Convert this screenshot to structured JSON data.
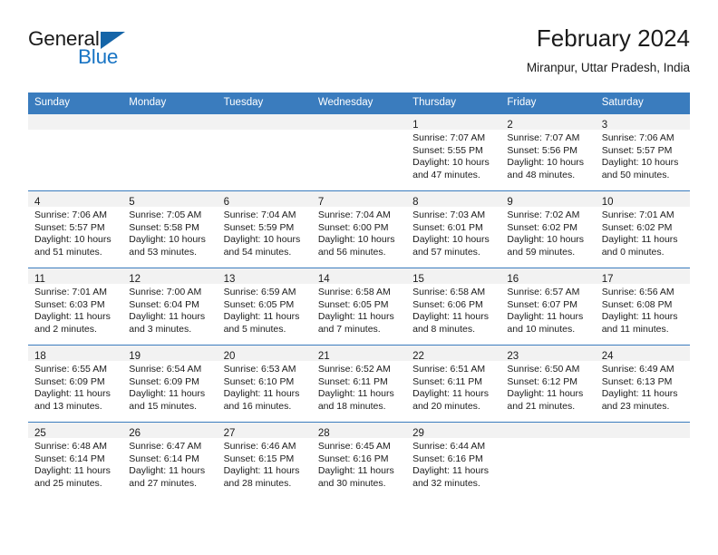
{
  "brand": {
    "name_part1": "General",
    "name_part2": "Blue",
    "triangle_color": "#1565a8",
    "blue_text_color": "#1874c4"
  },
  "header": {
    "title": "February 2024",
    "subtitle": "Miranpur, Uttar Pradesh, India"
  },
  "theme": {
    "header_bar_color": "#3a7cbe",
    "daynum_band_color": "#f2f2f2",
    "grid_line_color": "#3a7cbe"
  },
  "weekday_headers": [
    "Sunday",
    "Monday",
    "Tuesday",
    "Wednesday",
    "Thursday",
    "Friday",
    "Saturday"
  ],
  "weeks": [
    [
      {
        "day": "",
        "lines": []
      },
      {
        "day": "",
        "lines": []
      },
      {
        "day": "",
        "lines": []
      },
      {
        "day": "",
        "lines": []
      },
      {
        "day": "1",
        "lines": [
          "Sunrise: 7:07 AM",
          "Sunset: 5:55 PM",
          "Daylight: 10 hours",
          "and 47 minutes."
        ]
      },
      {
        "day": "2",
        "lines": [
          "Sunrise: 7:07 AM",
          "Sunset: 5:56 PM",
          "Daylight: 10 hours",
          "and 48 minutes."
        ]
      },
      {
        "day": "3",
        "lines": [
          "Sunrise: 7:06 AM",
          "Sunset: 5:57 PM",
          "Daylight: 10 hours",
          "and 50 minutes."
        ]
      }
    ],
    [
      {
        "day": "4",
        "lines": [
          "Sunrise: 7:06 AM",
          "Sunset: 5:57 PM",
          "Daylight: 10 hours",
          "and 51 minutes."
        ]
      },
      {
        "day": "5",
        "lines": [
          "Sunrise: 7:05 AM",
          "Sunset: 5:58 PM",
          "Daylight: 10 hours",
          "and 53 minutes."
        ]
      },
      {
        "day": "6",
        "lines": [
          "Sunrise: 7:04 AM",
          "Sunset: 5:59 PM",
          "Daylight: 10 hours",
          "and 54 minutes."
        ]
      },
      {
        "day": "7",
        "lines": [
          "Sunrise: 7:04 AM",
          "Sunset: 6:00 PM",
          "Daylight: 10 hours",
          "and 56 minutes."
        ]
      },
      {
        "day": "8",
        "lines": [
          "Sunrise: 7:03 AM",
          "Sunset: 6:01 PM",
          "Daylight: 10 hours",
          "and 57 minutes."
        ]
      },
      {
        "day": "9",
        "lines": [
          "Sunrise: 7:02 AM",
          "Sunset: 6:02 PM",
          "Daylight: 10 hours",
          "and 59 minutes."
        ]
      },
      {
        "day": "10",
        "lines": [
          "Sunrise: 7:01 AM",
          "Sunset: 6:02 PM",
          "Daylight: 11 hours",
          "and 0 minutes."
        ]
      }
    ],
    [
      {
        "day": "11",
        "lines": [
          "Sunrise: 7:01 AM",
          "Sunset: 6:03 PM",
          "Daylight: 11 hours",
          "and 2 minutes."
        ]
      },
      {
        "day": "12",
        "lines": [
          "Sunrise: 7:00 AM",
          "Sunset: 6:04 PM",
          "Daylight: 11 hours",
          "and 3 minutes."
        ]
      },
      {
        "day": "13",
        "lines": [
          "Sunrise: 6:59 AM",
          "Sunset: 6:05 PM",
          "Daylight: 11 hours",
          "and 5 minutes."
        ]
      },
      {
        "day": "14",
        "lines": [
          "Sunrise: 6:58 AM",
          "Sunset: 6:05 PM",
          "Daylight: 11 hours",
          "and 7 minutes."
        ]
      },
      {
        "day": "15",
        "lines": [
          "Sunrise: 6:58 AM",
          "Sunset: 6:06 PM",
          "Daylight: 11 hours",
          "and 8 minutes."
        ]
      },
      {
        "day": "16",
        "lines": [
          "Sunrise: 6:57 AM",
          "Sunset: 6:07 PM",
          "Daylight: 11 hours",
          "and 10 minutes."
        ]
      },
      {
        "day": "17",
        "lines": [
          "Sunrise: 6:56 AM",
          "Sunset: 6:08 PM",
          "Daylight: 11 hours",
          "and 11 minutes."
        ]
      }
    ],
    [
      {
        "day": "18",
        "lines": [
          "Sunrise: 6:55 AM",
          "Sunset: 6:09 PM",
          "Daylight: 11 hours",
          "and 13 minutes."
        ]
      },
      {
        "day": "19",
        "lines": [
          "Sunrise: 6:54 AM",
          "Sunset: 6:09 PM",
          "Daylight: 11 hours",
          "and 15 minutes."
        ]
      },
      {
        "day": "20",
        "lines": [
          "Sunrise: 6:53 AM",
          "Sunset: 6:10 PM",
          "Daylight: 11 hours",
          "and 16 minutes."
        ]
      },
      {
        "day": "21",
        "lines": [
          "Sunrise: 6:52 AM",
          "Sunset: 6:11 PM",
          "Daylight: 11 hours",
          "and 18 minutes."
        ]
      },
      {
        "day": "22",
        "lines": [
          "Sunrise: 6:51 AM",
          "Sunset: 6:11 PM",
          "Daylight: 11 hours",
          "and 20 minutes."
        ]
      },
      {
        "day": "23",
        "lines": [
          "Sunrise: 6:50 AM",
          "Sunset: 6:12 PM",
          "Daylight: 11 hours",
          "and 21 minutes."
        ]
      },
      {
        "day": "24",
        "lines": [
          "Sunrise: 6:49 AM",
          "Sunset: 6:13 PM",
          "Daylight: 11 hours",
          "and 23 minutes."
        ]
      }
    ],
    [
      {
        "day": "25",
        "lines": [
          "Sunrise: 6:48 AM",
          "Sunset: 6:14 PM",
          "Daylight: 11 hours",
          "and 25 minutes."
        ]
      },
      {
        "day": "26",
        "lines": [
          "Sunrise: 6:47 AM",
          "Sunset: 6:14 PM",
          "Daylight: 11 hours",
          "and 27 minutes."
        ]
      },
      {
        "day": "27",
        "lines": [
          "Sunrise: 6:46 AM",
          "Sunset: 6:15 PM",
          "Daylight: 11 hours",
          "and 28 minutes."
        ]
      },
      {
        "day": "28",
        "lines": [
          "Sunrise: 6:45 AM",
          "Sunset: 6:16 PM",
          "Daylight: 11 hours",
          "and 30 minutes."
        ]
      },
      {
        "day": "29",
        "lines": [
          "Sunrise: 6:44 AM",
          "Sunset: 6:16 PM",
          "Daylight: 11 hours",
          "and 32 minutes."
        ]
      },
      {
        "day": "",
        "lines": []
      },
      {
        "day": "",
        "lines": []
      }
    ]
  ]
}
